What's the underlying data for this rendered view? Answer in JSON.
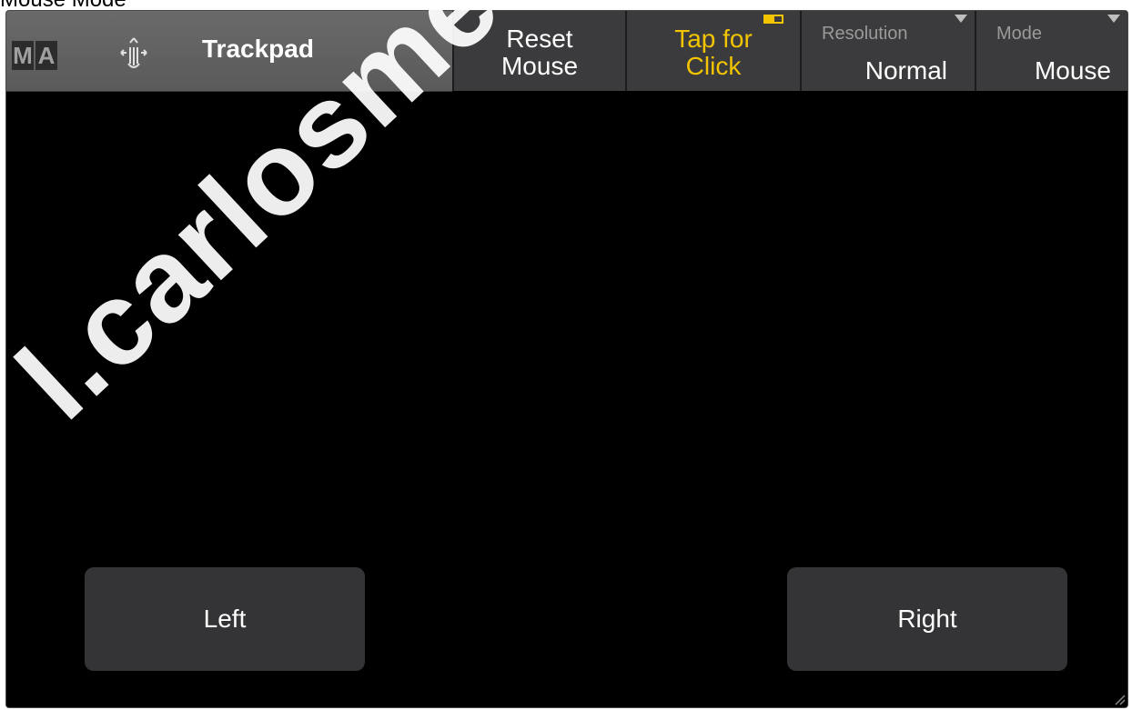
{
  "caption": "Mouse Mode",
  "header": {
    "logo_letters": [
      "M",
      "A"
    ],
    "gesture_icon": "touch-gesture-icon",
    "title": "Trackpad"
  },
  "toolbar": {
    "reset": {
      "line1": "Reset",
      "line2": "Mouse"
    },
    "tap": {
      "line1": "Tap for",
      "line2": "Click",
      "active": true,
      "accent_color": "#f2c500"
    },
    "resolution": {
      "label": "Resolution",
      "value": "Normal"
    },
    "mode": {
      "label": "Mode",
      "value": "Mouse"
    }
  },
  "buttons": {
    "left": "Left",
    "right": "Right"
  },
  "watermark": "l.carlosmendoza"
}
